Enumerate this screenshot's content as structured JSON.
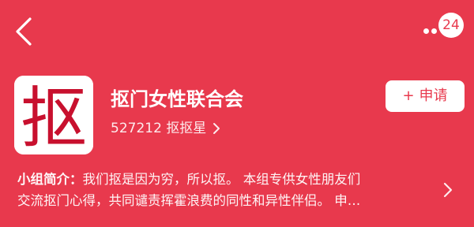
{
  "header": {
    "back_icon": "chevron-left-icon",
    "more_icon": "more-dots-icon",
    "notification_count": "24"
  },
  "group": {
    "logo_text": "抠",
    "name": "抠门女性联合会",
    "member_count": "527212",
    "member_title": "抠抠星",
    "apply_label": "申请",
    "apply_icon": "plus-icon"
  },
  "intro": {
    "label": "小组简介：",
    "line1": "我们抠是因为穷，所以抠。  本组专供女性朋友们",
    "line2": "交流抠门心得，共同谴责挥霍浪费的同性和异性伴侣。 申…"
  },
  "colors": {
    "background": "#e8394d",
    "logo_glyph": "#c8102e",
    "button_bg": "#ffffff"
  }
}
